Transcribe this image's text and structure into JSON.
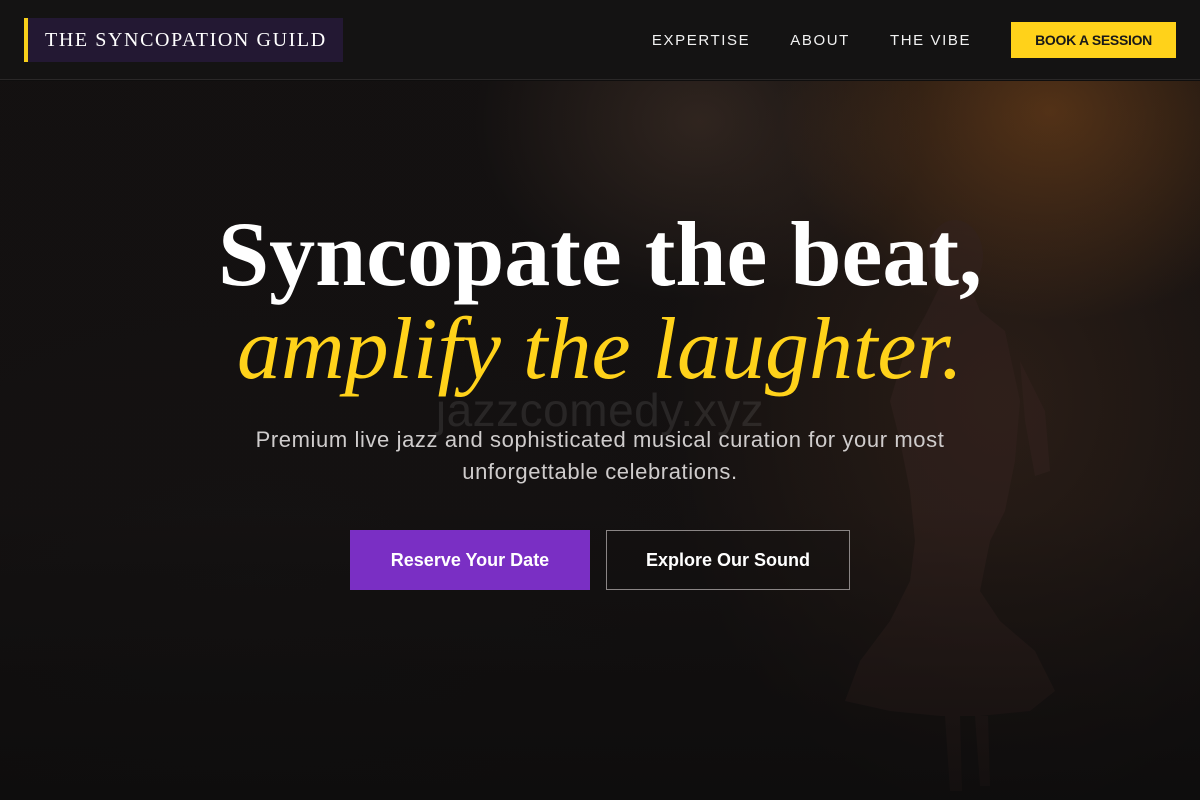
{
  "header": {
    "logo_text": "THE SYNCOPATION GUILD",
    "nav_items": [
      {
        "label": "EXPERTISE"
      },
      {
        "label": "ABOUT"
      },
      {
        "label": "THE VIBE"
      }
    ],
    "cta_label": "BOOK A SESSION"
  },
  "hero": {
    "title_line1": "Syncopate the beat,",
    "title_line2": "amplify the laughter.",
    "watermark": "jazzcomedy.xyz",
    "subtitle": "Premium live jazz and sophisticated musical curation for your most unforgettable celebrations.",
    "primary_button": "Reserve Your Date",
    "secondary_button": "Explore Our Sound"
  },
  "colors": {
    "accent_yellow": "#ffd21a",
    "accent_purple": "#7a2fc4",
    "logo_background": "#231833",
    "background": "#0f0e0e"
  },
  "icons": {
    "hero_image": "performer-silhouette"
  }
}
